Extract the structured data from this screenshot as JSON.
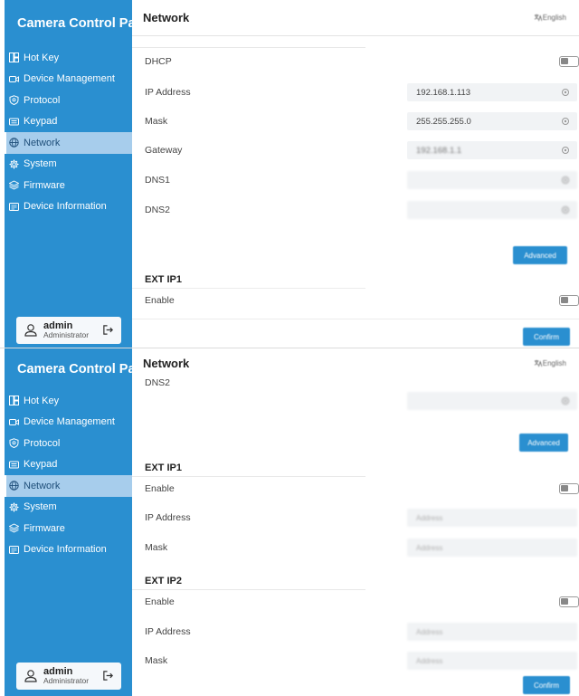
{
  "app": {
    "title": "Camera Control Panel"
  },
  "page": {
    "title": "Network",
    "language": "English"
  },
  "sidebar": {
    "items": [
      {
        "label": "Hot Key",
        "icon": "hotkey-icon"
      },
      {
        "label": "Device Management",
        "icon": "camera-icon"
      },
      {
        "label": "Protocol",
        "icon": "shield-icon"
      },
      {
        "label": "Keypad",
        "icon": "keyboard-icon"
      },
      {
        "label": "Network",
        "icon": "globe-icon",
        "active": true
      },
      {
        "label": "System",
        "icon": "gear-icon"
      },
      {
        "label": "Firmware",
        "icon": "layers-icon"
      },
      {
        "label": "Device Information",
        "icon": "info-card-icon"
      }
    ]
  },
  "user": {
    "name": "admin",
    "role": "Administrator"
  },
  "network": {
    "dhcp_label": "DHCP",
    "dhcp_enabled": false,
    "ip_label": "IP Address",
    "ip_value": "192.168.1.113",
    "mask_label": "Mask",
    "mask_value": "255.255.255.0",
    "gateway_label": "Gateway",
    "gateway_value": "192.168.1.1",
    "dns1_label": "DNS1",
    "dns1_value": "",
    "dns2_label": "DNS2",
    "dns2_value": ""
  },
  "advanced_button": "Advanced",
  "ext_ip1": {
    "title": "EXT IP1",
    "enable_label": "Enable",
    "enabled": false,
    "ip_label": "IP Address",
    "ip_placeholder": "Address",
    "mask_label": "Mask",
    "mask_placeholder": "Address"
  },
  "ext_ip2": {
    "title": "EXT IP2",
    "enable_label": "Enable",
    "enabled": false,
    "ip_label": "IP Address",
    "ip_placeholder": "Address",
    "mask_label": "Mask",
    "mask_placeholder": "Address"
  },
  "confirm_button": "Confirm",
  "colors": {
    "sidebar": "#2a8fd0",
    "active_item": "#a7cdec",
    "primary_button": "#2a8fd0"
  }
}
